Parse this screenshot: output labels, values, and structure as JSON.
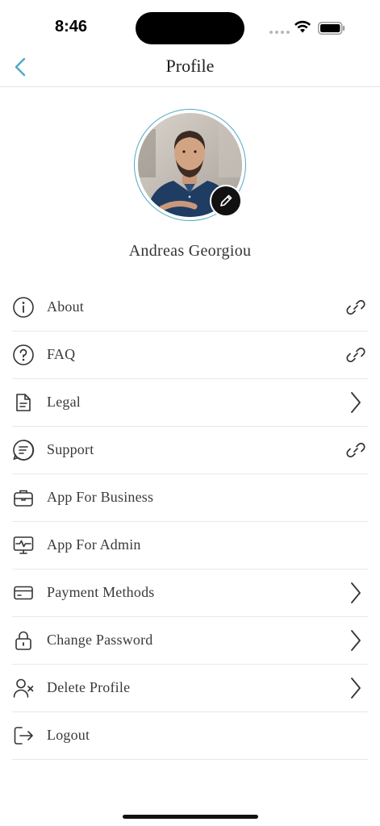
{
  "status_bar": {
    "time": "8:46"
  },
  "header": {
    "title": "Profile"
  },
  "profile": {
    "name": "Andreas Georgiou"
  },
  "colors": {
    "accent": "#4fa8c7",
    "text": "#3a3a3a",
    "divider": "#e8e8e8"
  },
  "menu": [
    {
      "label": "About",
      "icon": "info-icon",
      "trailing": "link-icon"
    },
    {
      "label": "FAQ",
      "icon": "question-icon",
      "trailing": "link-icon"
    },
    {
      "label": "Legal",
      "icon": "document-icon",
      "trailing": "chevron-right-icon"
    },
    {
      "label": "Support",
      "icon": "support-icon",
      "trailing": "link-icon"
    },
    {
      "label": "App For Business",
      "icon": "briefcase-icon",
      "trailing": ""
    },
    {
      "label": "App For Admin",
      "icon": "monitor-pulse-icon",
      "trailing": ""
    },
    {
      "label": "Payment Methods",
      "icon": "credit-card-icon",
      "trailing": "chevron-right-icon"
    },
    {
      "label": "Change Password",
      "icon": "lock-icon",
      "trailing": "chevron-right-icon"
    },
    {
      "label": "Delete Profile",
      "icon": "user-remove-icon",
      "trailing": "chevron-right-icon"
    },
    {
      "label": "Logout",
      "icon": "logout-icon",
      "trailing": ""
    }
  ]
}
